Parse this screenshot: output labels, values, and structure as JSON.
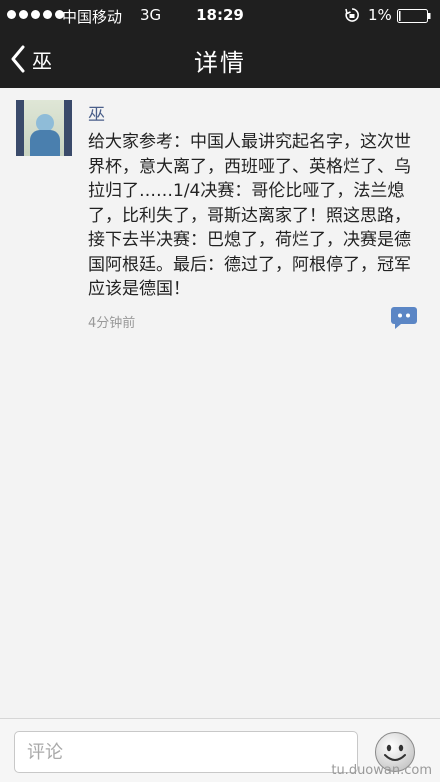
{
  "status_bar": {
    "carrier": "中国移动",
    "network": "3G",
    "time": "18:29",
    "battery": "1%"
  },
  "nav": {
    "back_label": "巫",
    "title": "详情"
  },
  "post": {
    "username": "巫",
    "content": "给大家参考：中国人最讲究起名字，这次世界杯，意大离了，西班哑了、英格烂了、乌拉归了……1/4决赛：哥伦比哑了，法兰熄了，比利失了，哥斯达离家了！照这思路，接下去半决赛：巴熄了，荷烂了，决赛是德国阿根廷。最后：德过了，阿根停了，冠军应该是德国！",
    "time_ago": "4分钟前"
  },
  "comment_bar": {
    "placeholder": "评论"
  },
  "watermark": "tu.duowan.com",
  "colors": {
    "bar_background": "#1f1f1f",
    "username": "#4a5f8a",
    "comment_icon": "#5b86c5"
  },
  "icons": [
    "signal-dots-icon",
    "rotation-lock-icon",
    "battery-icon",
    "back-chevron-icon",
    "comment-bubble-icon",
    "emoji-icon"
  ]
}
